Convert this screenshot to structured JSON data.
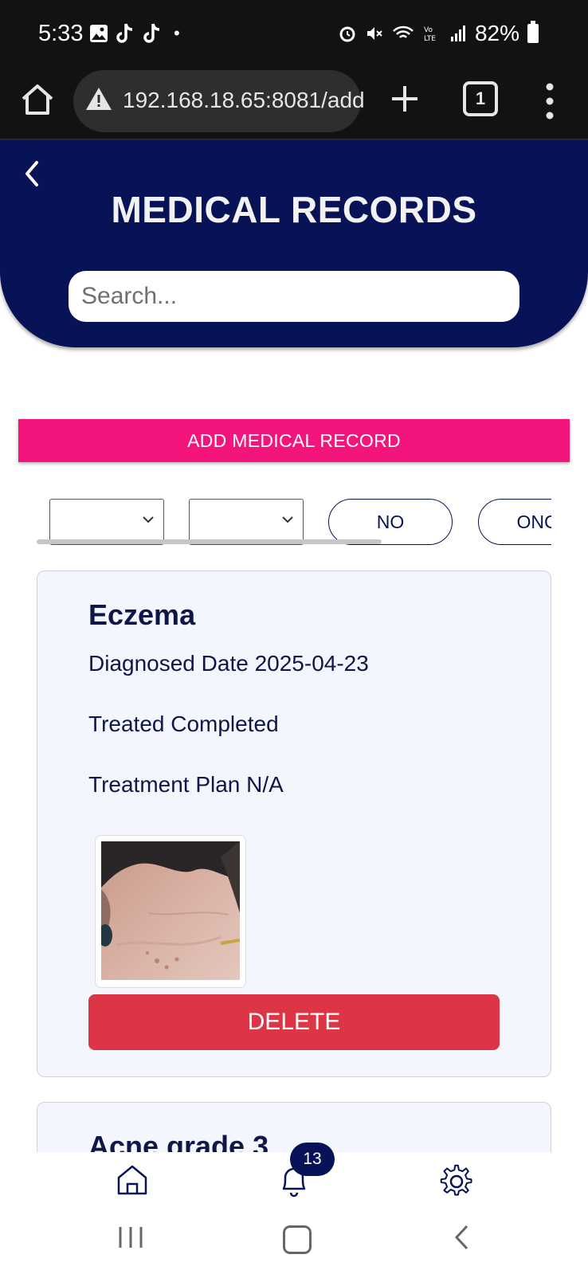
{
  "status_bar": {
    "time": "5:33",
    "battery": "82%",
    "dot": "•"
  },
  "browser": {
    "url": "192.168.18.65:8081/add",
    "tab_count": "1"
  },
  "header": {
    "title": "MEDICAL RECORDS",
    "search_placeholder": "Search..."
  },
  "actions": {
    "add_label": "ADD MEDICAL RECORD"
  },
  "filters": {
    "select_1": "",
    "select_2": "",
    "pills": [
      "NO",
      "ONC"
    ]
  },
  "records": [
    {
      "title": "Eczema",
      "diagnosed": "Diagnosed Date 2025-04-23",
      "treated": "Treated Completed",
      "plan": "Treatment Plan N/A",
      "delete_label": "DELETE"
    },
    {
      "title": "Acne grade 3"
    }
  ],
  "nav": {
    "notification_count": "13"
  },
  "colors": {
    "primary": "#081256",
    "accent": "#f4157c",
    "danger": "#dc3545",
    "card_bg": "#f3f6fc"
  }
}
